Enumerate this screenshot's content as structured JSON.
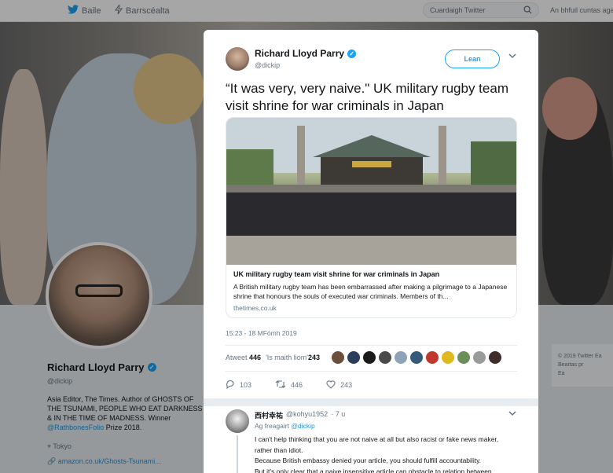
{
  "nav": {
    "home": "Baile",
    "moments": "Barrscéalta",
    "search_placeholder": "Cuardaigh Twitter",
    "account": "An bhfuil cuntas agat?"
  },
  "profile": {
    "name": "Richard Lloyd Parry",
    "handle": "@dickip",
    "bio": "Asia Editor, The Times. Author of GHOSTS OF THE TSUNAMI, PEOPLE WHO EAT DARKNESS & IN THE TIME OF MADNESS. Winner",
    "bio_link": "@RathbonesFolio",
    "bio_end": " Prize 2018.",
    "location": "Tokyo",
    "url": "amazon.co.uk/Ghosts-Tsunami..."
  },
  "footer": {
    "line1": "© 2019 Twitter  Ea",
    "line2": "Beartas pr",
    "line3": "Ea"
  },
  "tweet": {
    "author": "Richard Lloyd Parry",
    "handle": "@dickip",
    "follow_label": "Lean",
    "text": "“It was very, very naive.\" UK military rugby team visit shrine for war criminals in Japan",
    "card_title": "UK military rugby team visit shrine for war criminals in Japan",
    "card_desc": "A British military rugby team has been embarrassed after making a pilgrimage to a Japanese shrine that honours the souls of executed war criminals. Members of th...",
    "card_domain": "thetimes.co.uk",
    "timestamp": "15:23 - 18 MFómh 2019",
    "retweets_label": "Atweet",
    "retweets": "446",
    "likes_label": "'Is maith liom'",
    "likes": "243",
    "likers": [
      "#6b4f3a",
      "#2d3e5c",
      "#1a1a1a",
      "#4a4a4a",
      "#8fa3b8",
      "#355a7a",
      "#c0392b",
      "#e0b820",
      "#6b8e5a",
      "#9a9a9a",
      "#3f2d2d"
    ],
    "reply_count": "103",
    "retweet_count": "446",
    "like_count": "243"
  },
  "reply": {
    "name": "西村幸祐",
    "handle": "@kohyu1952",
    "time": "· 7 u",
    "to_label": "Ag freagairt",
    "to_handle": "@dickip",
    "lines": [
      "I can't help thinking that you are not naive at all but also racist or fake news maker,",
      "rather than idiot.",
      "Because British embassy denied your article, you should fulfill accountability.",
      "But it's only clear that a naive insensitive article can obstacle to relation between...."
    ]
  },
  "colors": {
    "accent": "#1da1f2",
    "link": "#1b95e0"
  }
}
